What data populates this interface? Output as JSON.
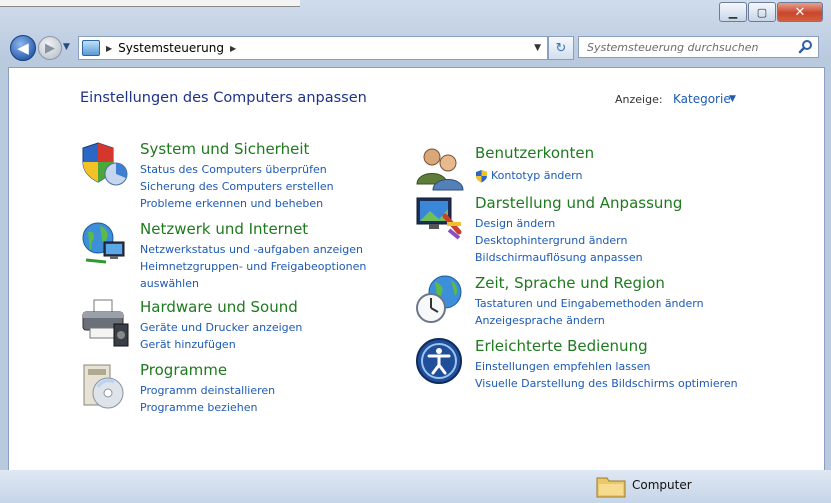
{
  "window": {
    "minimize_glyph": "▁",
    "maximize_glyph": "▢",
    "close_glyph": "✕"
  },
  "nav": {
    "back_glyph": "◀",
    "forward_glyph": "▶",
    "history_glyph": "▼",
    "breadcrumb_arrow": "▶",
    "address_text": "Systemsteuerung",
    "address_drop_glyph": "▼",
    "refresh_glyph": "↻",
    "search_placeholder": "Systemsteuerung durchsuchen"
  },
  "main": {
    "heading": "Einstellungen des Computers anpassen",
    "view_label": "Anzeige:",
    "view_value": "Kategorie",
    "view_arrow": "▼"
  },
  "categories": [
    {
      "title": "System und Sicherheit",
      "icon": "shield-icon",
      "links": [
        "Status des Computers überprüfen",
        "Sicherung des Computers erstellen",
        "Probleme erkennen und beheben"
      ]
    },
    {
      "title": "Netzwerk und Internet",
      "icon": "network-globe-icon",
      "links": [
        "Netzwerkstatus und -aufgaben anzeigen",
        "Heimnetzgruppen- und Freigabeoptionen",
        "auswählen"
      ]
    },
    {
      "title": "Hardware und Sound",
      "icon": "printer-icon",
      "links": [
        "Geräte und Drucker anzeigen",
        "Gerät hinzufügen"
      ]
    },
    {
      "title": "Programme",
      "icon": "programs-disc-icon",
      "links": [
        "Programm deinstallieren",
        "Programme beziehen"
      ]
    },
    {
      "title": "Benutzerkonten",
      "icon": "users-icon",
      "links": [
        "Kontotyp ändern"
      ]
    },
    {
      "title": "Darstellung und Anpassung",
      "icon": "display-icon",
      "links": [
        "Design ändern",
        "Desktophintergrund ändern",
        "Bildschirmauflösung anpassen"
      ]
    },
    {
      "title": "Zeit, Sprache und Region",
      "icon": "clock-globe-icon",
      "links": [
        "Tastaturen und Eingabemethoden ändern",
        "Anzeigesprache ändern"
      ]
    },
    {
      "title": "Erleichterte Bedienung",
      "icon": "ease-of-access-icon",
      "links": [
        "Einstellungen empfehlen lassen",
        "Visuelle Darstellung des Bildschirms optimieren"
      ]
    }
  ],
  "statusbar": {
    "label": "Computer"
  }
}
